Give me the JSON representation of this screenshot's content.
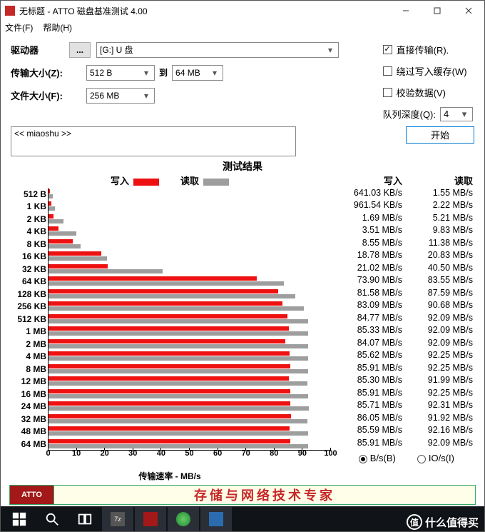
{
  "window": {
    "title": "无标题 - ATTO 磁盘基准测试 4.00",
    "menus": [
      "文件(F)",
      "帮助(H)"
    ]
  },
  "controls": {
    "drive_label": "驱动器",
    "dots": "...",
    "drive_value": "[G:] U 盘",
    "transfer_size_label": "传输大小(Z):",
    "ts_from": "512 B",
    "ts_to_label": "到",
    "ts_to": "64 MB",
    "file_size_label": "文件大小(F):",
    "file_size": "256 MB",
    "opt_direct": "直接传输(R).",
    "opt_bypass": "绕过写入缓存(W)",
    "opt_verify": "校验数据(V)",
    "queue_depth_label": "队列深度(Q):",
    "queue_depth": "4",
    "start": "开始",
    "desc": "<< miaoshu >>"
  },
  "results": {
    "title": "测试结果",
    "legend_write": "写入",
    "legend_read": "读取",
    "xaxis_title": "传输速率 - MB/s",
    "xticks": [
      "0",
      "10",
      "20",
      "30",
      "40",
      "50",
      "60",
      "70",
      "80",
      "90",
      "100"
    ],
    "col_write": "写入",
    "col_read": "读取",
    "radio_bs": "B/s(B)",
    "radio_ios": "IO/s(I)"
  },
  "chart_data": {
    "type": "bar",
    "xlabel": "传输速率 - MB/s",
    "xlim": [
      0,
      100
    ],
    "series_names": [
      "写入",
      "读取"
    ],
    "rows": [
      {
        "label": "512 B",
        "write_mb": 0.626,
        "read_mb": 1.55,
        "write_txt": "641.03 KB/s",
        "read_txt": "1.55 MB/s"
      },
      {
        "label": "1 KB",
        "write_mb": 0.939,
        "read_mb": 2.22,
        "write_txt": "961.54 KB/s",
        "read_txt": "2.22 MB/s"
      },
      {
        "label": "2 KB",
        "write_mb": 1.69,
        "read_mb": 5.21,
        "write_txt": "1.69 MB/s",
        "read_txt": "5.21 MB/s"
      },
      {
        "label": "4 KB",
        "write_mb": 3.51,
        "read_mb": 9.83,
        "write_txt": "3.51 MB/s",
        "read_txt": "9.83 MB/s"
      },
      {
        "label": "8 KB",
        "write_mb": 8.55,
        "read_mb": 11.38,
        "write_txt": "8.55 MB/s",
        "read_txt": "11.38 MB/s"
      },
      {
        "label": "16 KB",
        "write_mb": 18.78,
        "read_mb": 20.83,
        "write_txt": "18.78 MB/s",
        "read_txt": "20.83 MB/s"
      },
      {
        "label": "32 KB",
        "write_mb": 21.02,
        "read_mb": 40.5,
        "write_txt": "21.02 MB/s",
        "read_txt": "40.50 MB/s"
      },
      {
        "label": "64 KB",
        "write_mb": 73.9,
        "read_mb": 83.55,
        "write_txt": "73.90 MB/s",
        "read_txt": "83.55 MB/s"
      },
      {
        "label": "128 KB",
        "write_mb": 81.58,
        "read_mb": 87.59,
        "write_txt": "81.58 MB/s",
        "read_txt": "87.59 MB/s"
      },
      {
        "label": "256 KB",
        "write_mb": 83.09,
        "read_mb": 90.68,
        "write_txt": "83.09 MB/s",
        "read_txt": "90.68 MB/s"
      },
      {
        "label": "512 KB",
        "write_mb": 84.77,
        "read_mb": 92.09,
        "write_txt": "84.77 MB/s",
        "read_txt": "92.09 MB/s"
      },
      {
        "label": "1 MB",
        "write_mb": 85.33,
        "read_mb": 92.09,
        "write_txt": "85.33 MB/s",
        "read_txt": "92.09 MB/s"
      },
      {
        "label": "2 MB",
        "write_mb": 84.07,
        "read_mb": 92.09,
        "write_txt": "84.07 MB/s",
        "read_txt": "92.09 MB/s"
      },
      {
        "label": "4 MB",
        "write_mb": 85.62,
        "read_mb": 92.25,
        "write_txt": "85.62 MB/s",
        "read_txt": "92.25 MB/s"
      },
      {
        "label": "8 MB",
        "write_mb": 85.91,
        "read_mb": 92.25,
        "write_txt": "85.91 MB/s",
        "read_txt": "92.25 MB/s"
      },
      {
        "label": "12 MB",
        "write_mb": 85.3,
        "read_mb": 91.99,
        "write_txt": "85.30 MB/s",
        "read_txt": "91.99 MB/s"
      },
      {
        "label": "16 MB",
        "write_mb": 85.91,
        "read_mb": 92.25,
        "write_txt": "85.91 MB/s",
        "read_txt": "92.25 MB/s"
      },
      {
        "label": "24 MB",
        "write_mb": 85.71,
        "read_mb": 92.31,
        "write_txt": "85.71 MB/s",
        "read_txt": "92.31 MB/s"
      },
      {
        "label": "32 MB",
        "write_mb": 86.05,
        "read_mb": 91.92,
        "write_txt": "86.05 MB/s",
        "read_txt": "91.92 MB/s"
      },
      {
        "label": "48 MB",
        "write_mb": 85.59,
        "read_mb": 92.16,
        "write_txt": "85.59 MB/s",
        "read_txt": "92.16 MB/s"
      },
      {
        "label": "64 MB",
        "write_mb": 85.91,
        "read_mb": 92.09,
        "write_txt": "85.91 MB/s",
        "read_txt": "92.09 MB/s"
      }
    ]
  },
  "banner": {
    "logo": "ATTO",
    "text": "存储与网络技术专家"
  },
  "watermark": {
    "label": "值",
    "text": "什么值得买"
  }
}
